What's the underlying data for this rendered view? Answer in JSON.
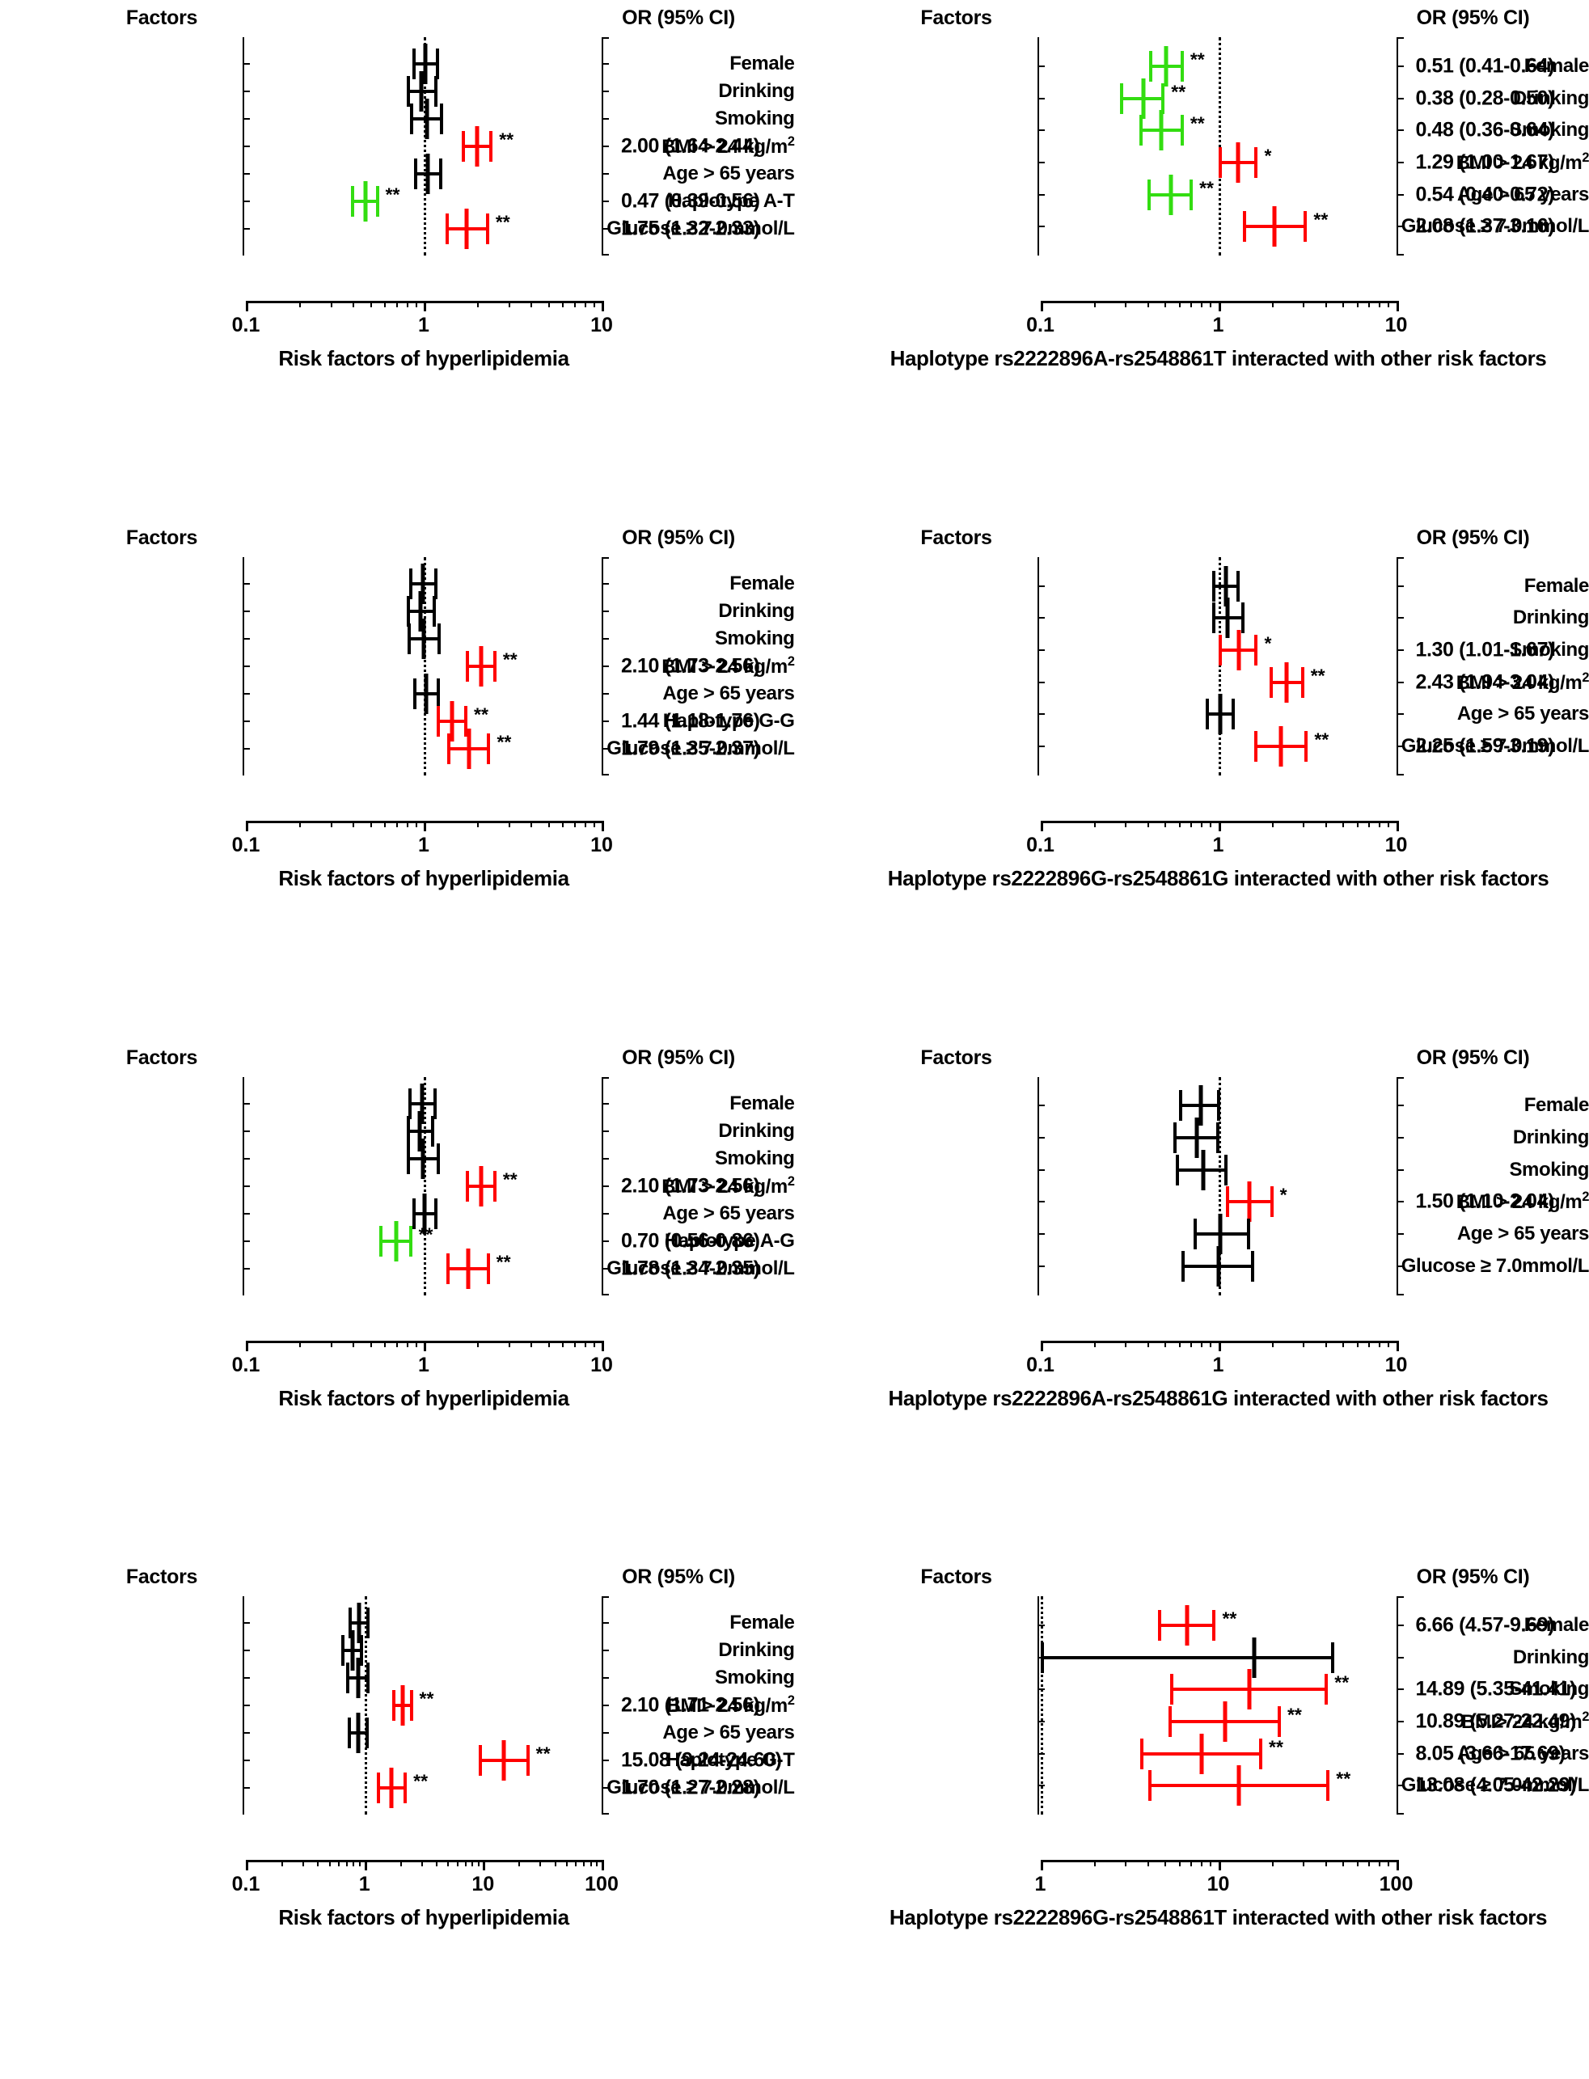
{
  "common": {
    "factors_header": "Factors",
    "or_header": "OR (95% CI)",
    "caption_risk": "Risk factors of hyperlipidemia",
    "star1": "*",
    "star2": "**"
  },
  "chart_data": {
    "type": "forest",
    "description": "Eight forest plots of odds ratios (OR) with 95% confidence intervals for risk factors of hyperlipidemia and haplotype interactions.",
    "panels": [
      {
        "id": "panel-1",
        "factors_header": "Factors",
        "or_header": "OR (95% CI)",
        "caption": "Risk factors of hyperlipidemia",
        "xlabel": "",
        "xscale": "log",
        "xlim": [
          0.1,
          10
        ],
        "xticks": [
          "0.1",
          "1",
          "10"
        ],
        "xtick_values": [
          0.1,
          1,
          10
        ],
        "null_value": 1,
        "rows": [
          {
            "label": "Female",
            "or": 1.02,
            "lo": 0.86,
            "hi": 1.22,
            "color": "#000000",
            "sig": "",
            "or_text": ""
          },
          {
            "label": "Drinking",
            "or": 0.97,
            "lo": 0.8,
            "hi": 1.2,
            "color": "#000000",
            "sig": "",
            "or_text": ""
          },
          {
            "label": "Smoking",
            "or": 1.04,
            "lo": 0.84,
            "hi": 1.28,
            "color": "#000000",
            "sig": "",
            "or_text": ""
          },
          {
            "label": "BMI > 24 kg/m2",
            "label_html": "BMI > 24 kg/m<sup>2</sup>",
            "or": 2.0,
            "lo": 1.64,
            "hi": 2.44,
            "color": "#FF0000",
            "sig": "**",
            "or_text": "2.00 (1.64-2.44)"
          },
          {
            "label": "Age > 65 years",
            "or": 1.05,
            "lo": 0.88,
            "hi": 1.27,
            "color": "#000000",
            "sig": "",
            "or_text": ""
          },
          {
            "label": "Haplotype A-T",
            "or": 0.47,
            "lo": 0.39,
            "hi": 0.56,
            "color": "#33DD11",
            "sig": "**",
            "or_text": "0.47 (0.39-0.56)"
          },
          {
            "label": "Glucose ≥ 7.0mmol/L",
            "or": 1.75,
            "lo": 1.32,
            "hi": 2.33,
            "color": "#FF0000",
            "sig": "**",
            "or_text": "1.75 (1.32-2.33)"
          }
        ]
      },
      {
        "id": "panel-2",
        "factors_header": "Factors",
        "or_header": "OR (95% CI)",
        "caption": "Haplotype rs2222896A-rs2548861T interacted with other risk factors",
        "xscale": "log",
        "xlim": [
          0.1,
          10
        ],
        "xticks": [
          "0.1",
          "1",
          "10"
        ],
        "xtick_values": [
          0.1,
          1,
          10
        ],
        "null_value": 1,
        "rows": [
          {
            "label": "Female",
            "or": 0.51,
            "lo": 0.41,
            "hi": 0.64,
            "color": "#33DD11",
            "sig": "**",
            "or_text": "0.51 (0.41-0.64)"
          },
          {
            "label": "Drinking",
            "or": 0.38,
            "lo": 0.28,
            "hi": 0.5,
            "color": "#33DD11",
            "sig": "**",
            "or_text": "0.38 (0.28-0.50)"
          },
          {
            "label": "Smoking",
            "or": 0.48,
            "lo": 0.36,
            "hi": 0.64,
            "color": "#33DD11",
            "sig": "**",
            "or_text": "0.48 (0.36-0.64)"
          },
          {
            "label": "BMI > 24 kg/m2",
            "label_html": "BMI > 24 kg/m<sup>2</sup>",
            "or": 1.29,
            "lo": 1.0,
            "hi": 1.67,
            "color": "#FF0000",
            "sig": "*",
            "or_text": "1.29 (1.00-1.67)"
          },
          {
            "label": "Age > 65 years",
            "or": 0.54,
            "lo": 0.4,
            "hi": 0.72,
            "color": "#33DD11",
            "sig": "**",
            "or_text": "0.54 (0.40-0.72)"
          },
          {
            "label": "Glucose ≥ 7.0mmol/L",
            "or": 2.08,
            "lo": 1.37,
            "hi": 3.16,
            "color": "#FF0000",
            "sig": "**",
            "or_text": "2.08 (1.37-3.16)"
          }
        ]
      },
      {
        "id": "panel-3",
        "factors_header": "Factors",
        "or_header": "OR (95% CI)",
        "caption": "Risk factors of hyperlipidemia",
        "xscale": "log",
        "xlim": [
          0.1,
          10
        ],
        "xticks": [
          "0.1",
          "1",
          "10"
        ],
        "xtick_values": [
          0.1,
          1,
          10
        ],
        "null_value": 1,
        "rows": [
          {
            "label": "Female",
            "or": 0.99,
            "lo": 0.83,
            "hi": 1.19,
            "color": "#000000",
            "sig": "",
            "or_text": ""
          },
          {
            "label": "Drinking",
            "or": 0.96,
            "lo": 0.8,
            "hi": 1.17,
            "color": "#000000",
            "sig": "",
            "or_text": ""
          },
          {
            "label": "Smoking",
            "or": 1.0,
            "lo": 0.81,
            "hi": 1.24,
            "color": "#000000",
            "sig": "",
            "or_text": ""
          },
          {
            "label": "BMI > 24 kg/m2",
            "label_html": "BMI > 24 kg/m<sup>2</sup>",
            "or": 2.1,
            "lo": 1.73,
            "hi": 2.56,
            "color": "#FF0000",
            "sig": "**",
            "or_text": "2.10 (1.73-2.56)"
          },
          {
            "label": "Age > 65 years",
            "or": 1.03,
            "lo": 0.87,
            "hi": 1.23,
            "color": "#000000",
            "sig": "",
            "or_text": ""
          },
          {
            "label": "Haplotype G-G",
            "or": 1.44,
            "lo": 1.18,
            "hi": 1.76,
            "color": "#FF0000",
            "sig": "**",
            "or_text": "1.44 (1.18-1.76)"
          },
          {
            "label": "Glucose ≥ 7.0mmol/L",
            "or": 1.79,
            "lo": 1.35,
            "hi": 2.37,
            "color": "#FF0000",
            "sig": "**",
            "or_text": "1.79 (1.35-2.37)"
          }
        ]
      },
      {
        "id": "panel-4",
        "factors_header": "Factors",
        "or_header": "OR (95% CI)",
        "caption": "Haplotype rs2222896G-rs2548861G interacted with other risk factors",
        "xscale": "log",
        "xlim": [
          0.1,
          10
        ],
        "xticks": [
          "0.1",
          "1",
          "10"
        ],
        "xtick_values": [
          0.1,
          1,
          10
        ],
        "null_value": 1,
        "rows": [
          {
            "label": "Female",
            "or": 1.1,
            "lo": 0.92,
            "hi": 1.32,
            "color": "#000000",
            "sig": "",
            "or_text": ""
          },
          {
            "label": "Drinking",
            "or": 1.13,
            "lo": 0.92,
            "hi": 1.4,
            "color": "#000000",
            "sig": "",
            "or_text": ""
          },
          {
            "label": "Smoking",
            "or": 1.3,
            "lo": 1.01,
            "hi": 1.67,
            "color": "#FF0000",
            "sig": "*",
            "or_text": "1.30 (1.01-1.67)"
          },
          {
            "label": "BMI > 24 kg/m2",
            "label_html": "BMI > 24 kg/m<sup>2</sup>",
            "or": 2.43,
            "lo": 1.94,
            "hi": 3.04,
            "color": "#FF0000",
            "sig": "**",
            "or_text": "2.43 (1.94-3.04)"
          },
          {
            "label": "Age > 65 years",
            "or": 1.03,
            "lo": 0.85,
            "hi": 1.24,
            "color": "#000000",
            "sig": "",
            "or_text": ""
          },
          {
            "label": "Glucose ≥ 7.0mmol/L",
            "or": 2.25,
            "lo": 1.59,
            "hi": 3.19,
            "color": "#FF0000",
            "sig": "**",
            "or_text": "2.25 (1.59-3.19)"
          }
        ]
      },
      {
        "id": "panel-5",
        "factors_header": "Factors",
        "or_header": "OR (95% CI)",
        "caption": "Risk factors of hyperlipidemia",
        "xscale": "log",
        "xlim": [
          0.1,
          10
        ],
        "xticks": [
          "0.1",
          "1",
          "10"
        ],
        "xtick_values": [
          0.1,
          1,
          10
        ],
        "null_value": 1,
        "rows": [
          {
            "label": "Female",
            "or": 0.98,
            "lo": 0.82,
            "hi": 1.18,
            "color": "#000000",
            "sig": "",
            "or_text": ""
          },
          {
            "label": "Drinking",
            "or": 0.95,
            "lo": 0.8,
            "hi": 1.15,
            "color": "#000000",
            "sig": "",
            "or_text": ""
          },
          {
            "label": "Smoking",
            "or": 0.99,
            "lo": 0.8,
            "hi": 1.23,
            "color": "#000000",
            "sig": "",
            "or_text": ""
          },
          {
            "label": "BMI > 24 kg/m2",
            "label_html": "BMI > 24 kg/m<sup>2</sup>",
            "or": 2.1,
            "lo": 1.73,
            "hi": 2.56,
            "color": "#FF0000",
            "sig": "**",
            "or_text": "2.10 (1.73-2.56)"
          },
          {
            "label": "Age > 65 years",
            "or": 1.01,
            "lo": 0.86,
            "hi": 1.2,
            "color": "#000000",
            "sig": "",
            "or_text": ""
          },
          {
            "label": "Haplotype A-G",
            "or": 0.7,
            "lo": 0.56,
            "hi": 0.86,
            "color": "#33DD11",
            "sig": "**",
            "or_text": "0.70 (0.56-0.86)"
          },
          {
            "label": "Glucose ≥ 7.0mmol/L",
            "or": 1.78,
            "lo": 1.34,
            "hi": 2.35,
            "color": "#FF0000",
            "sig": "**",
            "or_text": "1.78 (1.34-2.35)"
          }
        ]
      },
      {
        "id": "panel-6",
        "factors_header": "Factors",
        "or_header": "OR (95% CI)",
        "caption": "Haplotype rs2222896A-rs2548861G interacted with other risk factors",
        "xscale": "log",
        "xlim": [
          0.1,
          10
        ],
        "xticks": [
          "0.1",
          "1",
          "10"
        ],
        "xtick_values": [
          0.1,
          1,
          10
        ],
        "null_value": 1,
        "rows": [
          {
            "label": "Female",
            "or": 0.8,
            "lo": 0.6,
            "hi": 1.03,
            "color": "#000000",
            "sig": "",
            "or_text": ""
          },
          {
            "label": "Drinking",
            "or": 0.76,
            "lo": 0.56,
            "hi": 1.02,
            "color": "#000000",
            "sig": "",
            "or_text": ""
          },
          {
            "label": "Smoking",
            "or": 0.82,
            "lo": 0.58,
            "hi": 1.13,
            "color": "#000000",
            "sig": "",
            "or_text": ""
          },
          {
            "label": "BMI > 24 kg/m2",
            "label_html": "BMI > 24 kg/m<sup>2</sup>",
            "or": 1.5,
            "lo": 1.1,
            "hi": 2.04,
            "color": "#FF0000",
            "sig": "*",
            "or_text": "1.50 (1.10-2.04)"
          },
          {
            "label": "Age > 65 years",
            "or": 1.03,
            "lo": 0.73,
            "hi": 1.52,
            "color": "#000000",
            "sig": "",
            "or_text": ""
          },
          {
            "label": "Glucose ≥ 7.0mmol/L",
            "or": 1.0,
            "lo": 0.62,
            "hi": 1.6,
            "color": "#000000",
            "sig": "",
            "or_text": ""
          }
        ]
      },
      {
        "id": "panel-7",
        "factors_header": "Factors",
        "or_header": "OR (95% CI)",
        "caption": "Risk factors of hyperlipidemia",
        "xscale": "log",
        "xlim": [
          0.1,
          100
        ],
        "xticks": [
          "0.1",
          "1",
          "10",
          "100"
        ],
        "xtick_values": [
          0.1,
          1,
          10,
          100
        ],
        "null_value": 1,
        "rows": [
          {
            "label": "Female",
            "or": 0.9,
            "lo": 0.74,
            "hi": 1.1,
            "color": "#000000",
            "sig": "",
            "or_text": ""
          },
          {
            "label": "Drinking",
            "or": 0.79,
            "lo": 0.64,
            "hi": 0.98,
            "color": "#000000",
            "sig": "",
            "or_text": ""
          },
          {
            "label": "Smoking",
            "or": 0.88,
            "lo": 0.7,
            "hi": 1.1,
            "color": "#000000",
            "sig": "",
            "or_text": ""
          },
          {
            "label": "BMI> 24 kg/m2",
            "label_html": "BMI> 24 kg/m<sup>2</sup>",
            "or": 2.1,
            "lo": 1.71,
            "hi": 2.56,
            "color": "#FF0000",
            "sig": "**",
            "or_text": "2.10 (1.71-2.56)"
          },
          {
            "label": "Age > 65 years",
            "or": 0.88,
            "lo": 0.72,
            "hi": 1.08,
            "color": "#000000",
            "sig": "",
            "or_text": ""
          },
          {
            "label": "Haplotype G-T",
            "or": 15.08,
            "lo": 9.24,
            "hi": 24.6,
            "color": "#FF0000",
            "sig": "**",
            "or_text": "15.08 (9.24-24.60)"
          },
          {
            "label": "Glucose ≥ 7.0mmol/L",
            "or": 1.7,
            "lo": 1.27,
            "hi": 2.28,
            "color": "#FF0000",
            "sig": "**",
            "or_text": "1.70 (1.27-2.28)"
          }
        ]
      },
      {
        "id": "panel-8",
        "factors_header": "Factors",
        "or_header": "OR (95% CI)",
        "caption": "Haplotype rs2222896G-rs2548861T interacted with other risk factors",
        "xscale": "log",
        "xlim": [
          1,
          100
        ],
        "xticks": [
          "1",
          "10",
          "100"
        ],
        "xtick_values": [
          1,
          10,
          100
        ],
        "null_value": 1,
        "rows": [
          {
            "label": "Female",
            "or": 6.66,
            "lo": 4.57,
            "hi": 9.69,
            "color": "#FF0000",
            "sig": "**",
            "or_text": "6.66 (4.57-9.69)"
          },
          {
            "label": "Drinking",
            "or": 16.0,
            "lo": 1.0,
            "hi": 45.0,
            "color": "#000000",
            "sig": "",
            "or_text": ""
          },
          {
            "label": "Smoking",
            "or": 14.89,
            "lo": 5.35,
            "hi": 41.41,
            "color": "#FF0000",
            "sig": "**",
            "or_text": "14.89 (5.35-41.41)"
          },
          {
            "label": "BMI> 24 kg/m2",
            "label_html": "BMI> 24 kg/m<sup>2</sup>",
            "or": 10.89,
            "lo": 5.27,
            "hi": 22.49,
            "color": "#FF0000",
            "sig": "**",
            "or_text": "10.89 (5.27-22.49)"
          },
          {
            "label": "Age > 65 years",
            "or": 8.05,
            "lo": 3.66,
            "hi": 17.69,
            "color": "#FF0000",
            "sig": "**",
            "or_text": "8.05 (3.66-17.69)"
          },
          {
            "label": "Glucose ≥ 7.0mmol/L",
            "or": 13.08,
            "lo": 4.05,
            "hi": 42.29,
            "color": "#FF0000",
            "sig": "**",
            "or_text": "13.08 (4.05-42.29)"
          }
        ]
      }
    ]
  }
}
